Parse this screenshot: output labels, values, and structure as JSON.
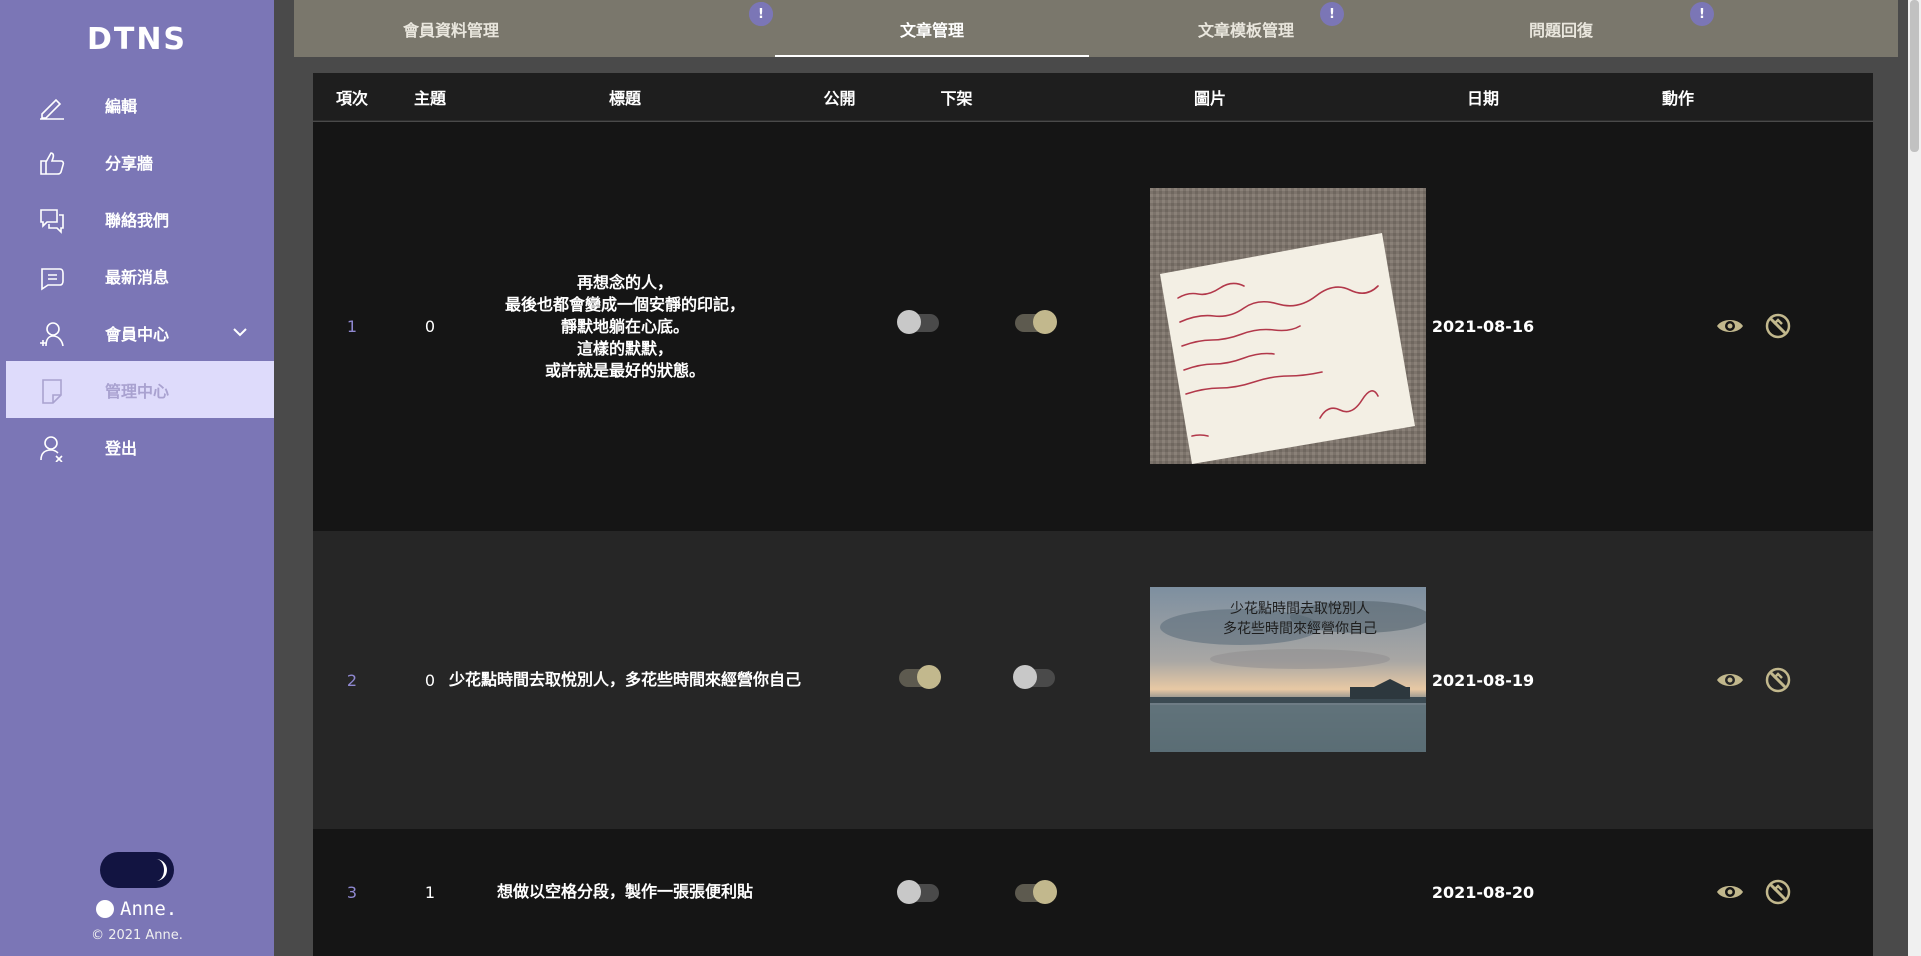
{
  "sidebar": {
    "logo": "DTNS",
    "items": [
      {
        "label": "編輯",
        "icon": "pen-icon"
      },
      {
        "label": "分享牆",
        "icon": "thumbs-up-icon"
      },
      {
        "label": "聯絡我們",
        "icon": "chat-bubbles-icon"
      },
      {
        "label": "最新消息",
        "icon": "message-lines-icon"
      },
      {
        "label": "會員中心",
        "icon": "user-add-icon"
      },
      {
        "label": "管理中心",
        "icon": "note-icon"
      },
      {
        "label": "登出",
        "icon": "user-logout-icon"
      }
    ],
    "active_item": "管理中心",
    "user_name": "Anne.",
    "copyright": "© 2021 Anne."
  },
  "tabs": [
    {
      "label": "會員資料管理",
      "badge": "!"
    },
    {
      "label": "文章管理",
      "badge": "!",
      "active": true
    },
    {
      "label": "文章模板管理",
      "badge": ""
    },
    {
      "label": "問題回復",
      "badge": "!"
    }
  ],
  "table": {
    "headers": [
      "項次",
      "主題",
      "標題",
      "公開",
      "下架",
      "圖片",
      "日期",
      "動作"
    ],
    "rows": [
      {
        "index": "1",
        "topic": "0",
        "title_lines": [
          "再想念的人，",
          "最後也都會變成一個安靜的印記，",
          "靜默地躺在心底。",
          "這樣的默默，",
          "或許就是最好的狀態。"
        ],
        "public": false,
        "offline": true,
        "image": "handwritten-note-image",
        "date": "2021-08-16"
      },
      {
        "index": "2",
        "topic": "0",
        "title_lines": [
          "少花點時間去取悅別人，多花些時間來經營你自己"
        ],
        "public": true,
        "offline": false,
        "image": "lake-sunset-image",
        "image_text": [
          "少花點時間去取悅別人",
          "多花些時間來經營你自己"
        ],
        "date": "2021-08-19"
      },
      {
        "index": "3",
        "topic": "1",
        "title_lines": [
          "想做以空格分段，製作一張張便利貼"
        ],
        "public": false,
        "offline": true,
        "image": "",
        "date": "2021-08-20"
      }
    ]
  },
  "colors": {
    "sidebar": "#7b76b6",
    "tabbar": "#7a776c",
    "accent_gold": "#c2b88d",
    "index_purple": "#8f88d0"
  }
}
